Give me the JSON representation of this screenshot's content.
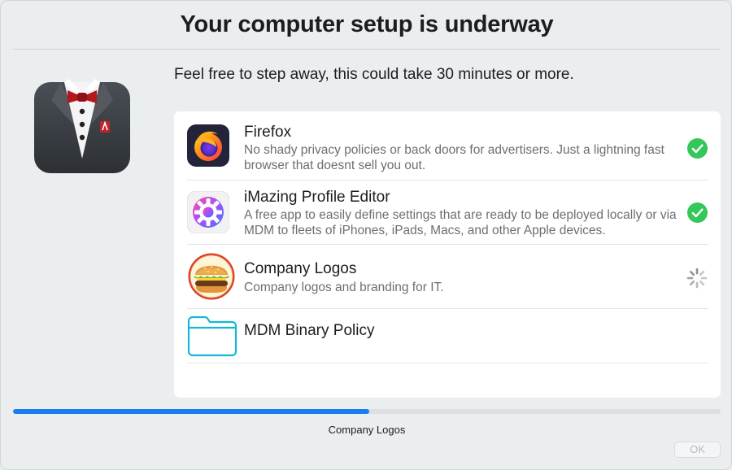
{
  "window": {
    "title": "Your computer setup is underway",
    "subtitle": "Feel free to step away, this could take 30 minutes or more."
  },
  "logo": {
    "icon": "tuxedo-logo-icon"
  },
  "items": [
    {
      "title": "Firefox",
      "description": "No shady privacy policies or back doors for advertisers. Just a lightning fast browser that doesnt sell you out.",
      "icon": "firefox-icon",
      "status": "completed"
    },
    {
      "title": "iMazing Profile Editor",
      "description": "A free app to easily define settings that are ready to be deployed locally or via MDM to fleets of iPhones, iPads, Macs, and other Apple devices.",
      "icon": "imazing-gear-icon",
      "status": "completed"
    },
    {
      "title": "Company Logos",
      "description": "Company logos and branding for IT.",
      "icon": "burger-icon",
      "status": "in-progress"
    },
    {
      "title": "MDM Binary Policy",
      "description": "",
      "icon": "folder-icon",
      "status": "pending"
    }
  ],
  "progress": {
    "fraction": 0.503,
    "status_text": "Company Logos"
  },
  "footer": {
    "ok_label": "OK"
  },
  "colors": {
    "accent": "#1a7cf0",
    "success": "#34c759",
    "folder": "#14b8d6"
  }
}
